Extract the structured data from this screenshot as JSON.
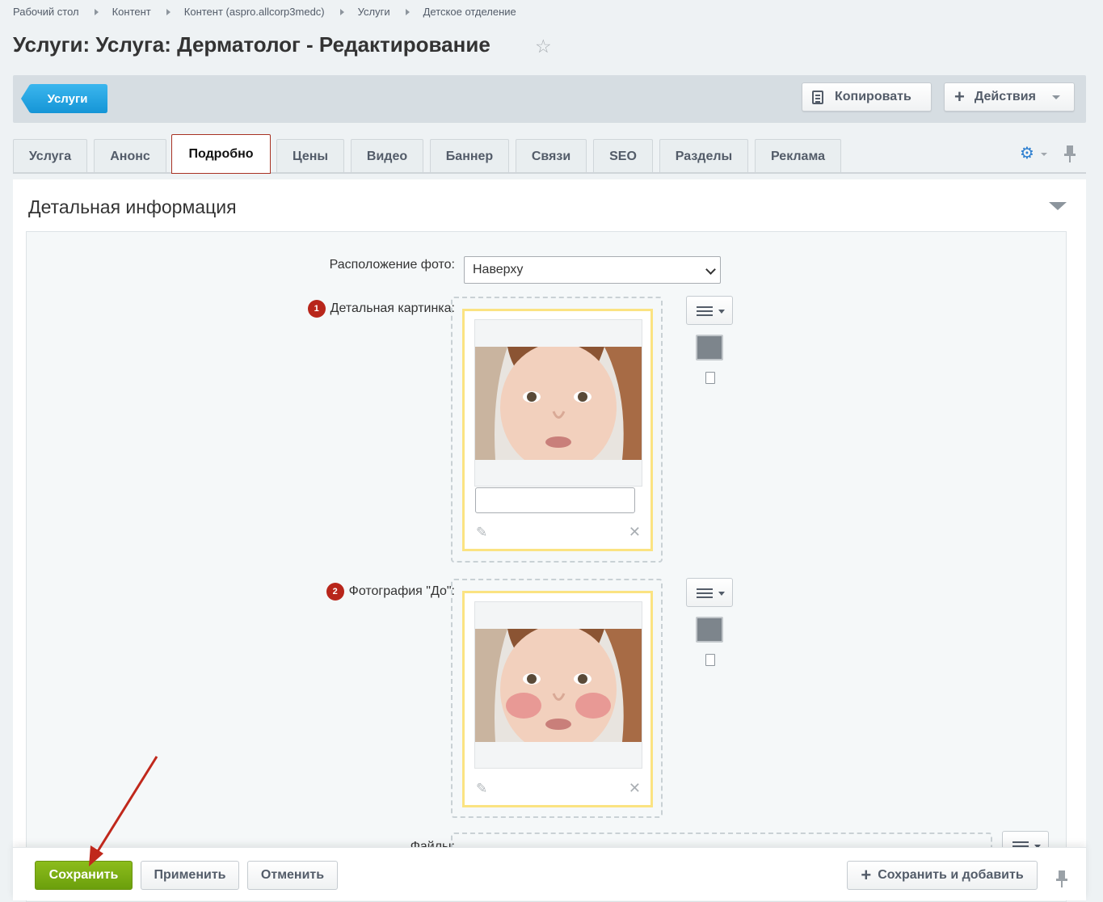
{
  "breadcrumb": [
    "Рабочий стол",
    "Контент",
    "Контент (aspro.allcorp3medc)",
    "Услуги",
    "Детское отделение"
  ],
  "title": "Услуги: Услуга: Дерматолог - Редактирование",
  "toolbar": {
    "back_label": "Услуги",
    "copy_label": "Копировать",
    "actions_label": "Действия"
  },
  "tabs": [
    "Услуга",
    "Анонс",
    "Подробно",
    "Цены",
    "Видео",
    "Баннер",
    "Связи",
    "SEO",
    "Разделы",
    "Реклама"
  ],
  "active_tab": "Подробно",
  "section": {
    "title": "Детальная информация",
    "photo_position_label": "Расположение фото:",
    "photo_position_value": "Наверху",
    "detail_image_label": "Детальная картинка:",
    "detail_image_badge": "1",
    "before_photo_label": "Фотография \"До\":",
    "before_photo_badge": "2",
    "files_label": "Файлы:"
  },
  "footer": {
    "save": "Сохранить",
    "apply": "Применить",
    "cancel": "Отменить",
    "save_add": "Сохранить и добавить"
  },
  "colors": {
    "accent_blue": "#1a9fe0",
    "save_green": "#7aab14",
    "active_tab_border": "#a83223",
    "badge_red": "#b8261b",
    "arrow_red": "#c0281c"
  }
}
